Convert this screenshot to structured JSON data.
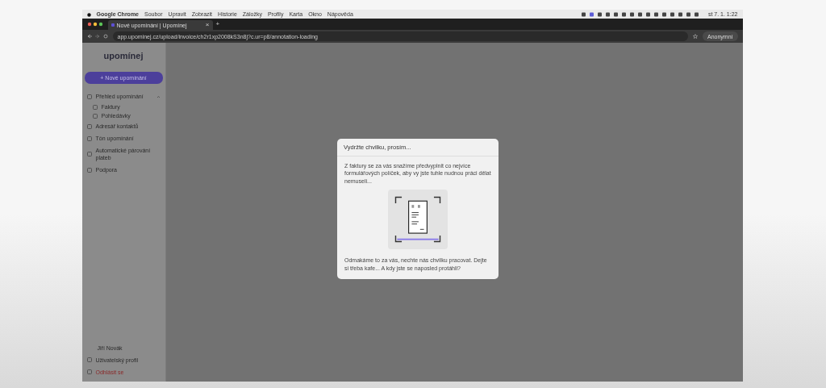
{
  "menu_bar": {
    "app": "Google Chrome",
    "items": [
      "Soubor",
      "Upravit",
      "Zobrazit",
      "Historie",
      "Záložky",
      "Profily",
      "Karta",
      "Okno",
      "Nápověda"
    ],
    "clock": "st 7. 1. 1:22"
  },
  "browser": {
    "tab": {
      "title": "Nové upomínání | Upomínej",
      "close": "×",
      "selected": true
    },
    "new_tab": "+",
    "url": "app.upominej.cz/upload/invoice/ch2r1xp2008kS3n8j?c.ur=p8/annotation-loading",
    "profile": "Anonymní"
  },
  "sidebar": {
    "logo": "upomínej",
    "new_button": "+ Nové upomínání",
    "items": [
      {
        "label": "Přehled upomínání",
        "expanded": true,
        "children": [
          {
            "label": "Faktury"
          },
          {
            "label": "Pohledávky"
          }
        ]
      },
      {
        "label": "Adresář kontaktů"
      },
      {
        "label": "Tón upomínání"
      },
      {
        "label": "Automatické párování plateb"
      },
      {
        "label": "Podpora"
      }
    ],
    "user": "Jiří Novák",
    "profile": "Uživatelský profil",
    "logout": "Odhlásit se"
  },
  "dialog": {
    "title": "Vydržte chvilku, prosím...",
    "intro": "Z faktury se za vás snažíme předvyplnit co nejvíce formulářových políček, aby vy jste tuhle nudnou práci dělat nemuseli...",
    "outro": "Odmakáme to za vás, nechte nás chvilku pracovat. Dejte si třeba kafe... A kdy jste se naposled protáhli?"
  }
}
